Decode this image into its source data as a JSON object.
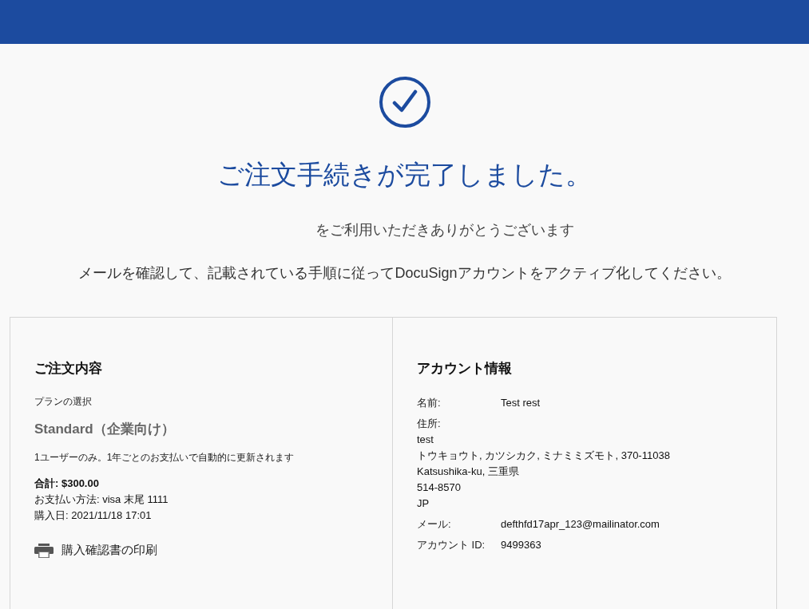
{
  "title": "ご注文手続きが完了しました。",
  "thanks": "をご利用いただきありがとうございます",
  "instruction": "メールを確認して、記載されている手順に従ってDocuSignアカウントをアクティブ化してください。",
  "order": {
    "heading": "ご注文内容",
    "plan_label": "プランの選択",
    "plan": "Standard（企業向け）",
    "plan_note": "1ユーザーのみ。1年ごとのお支払いで自動的に更新されます",
    "total": "合計: $300.00",
    "payment": "お支払い方法: visa 末尾 1111",
    "date": "購入日: 2021/11/18 17:01",
    "print_link": "購入確認書の印刷"
  },
  "account": {
    "heading": "アカウント情報",
    "name_label": "名前:",
    "name": "Test rest",
    "address_label": "住所:",
    "address_lines": [
      "test",
      "トウキョウト, カツシカク, ミナミミズモト, 370-11038",
      "Katsushika-ku, 三重県",
      "514-8570",
      "JP"
    ],
    "email_label": "メール:",
    "email": "defthfd17apr_123@mailinator.com",
    "id_label": "アカウント ID:",
    "id": "9499363"
  }
}
